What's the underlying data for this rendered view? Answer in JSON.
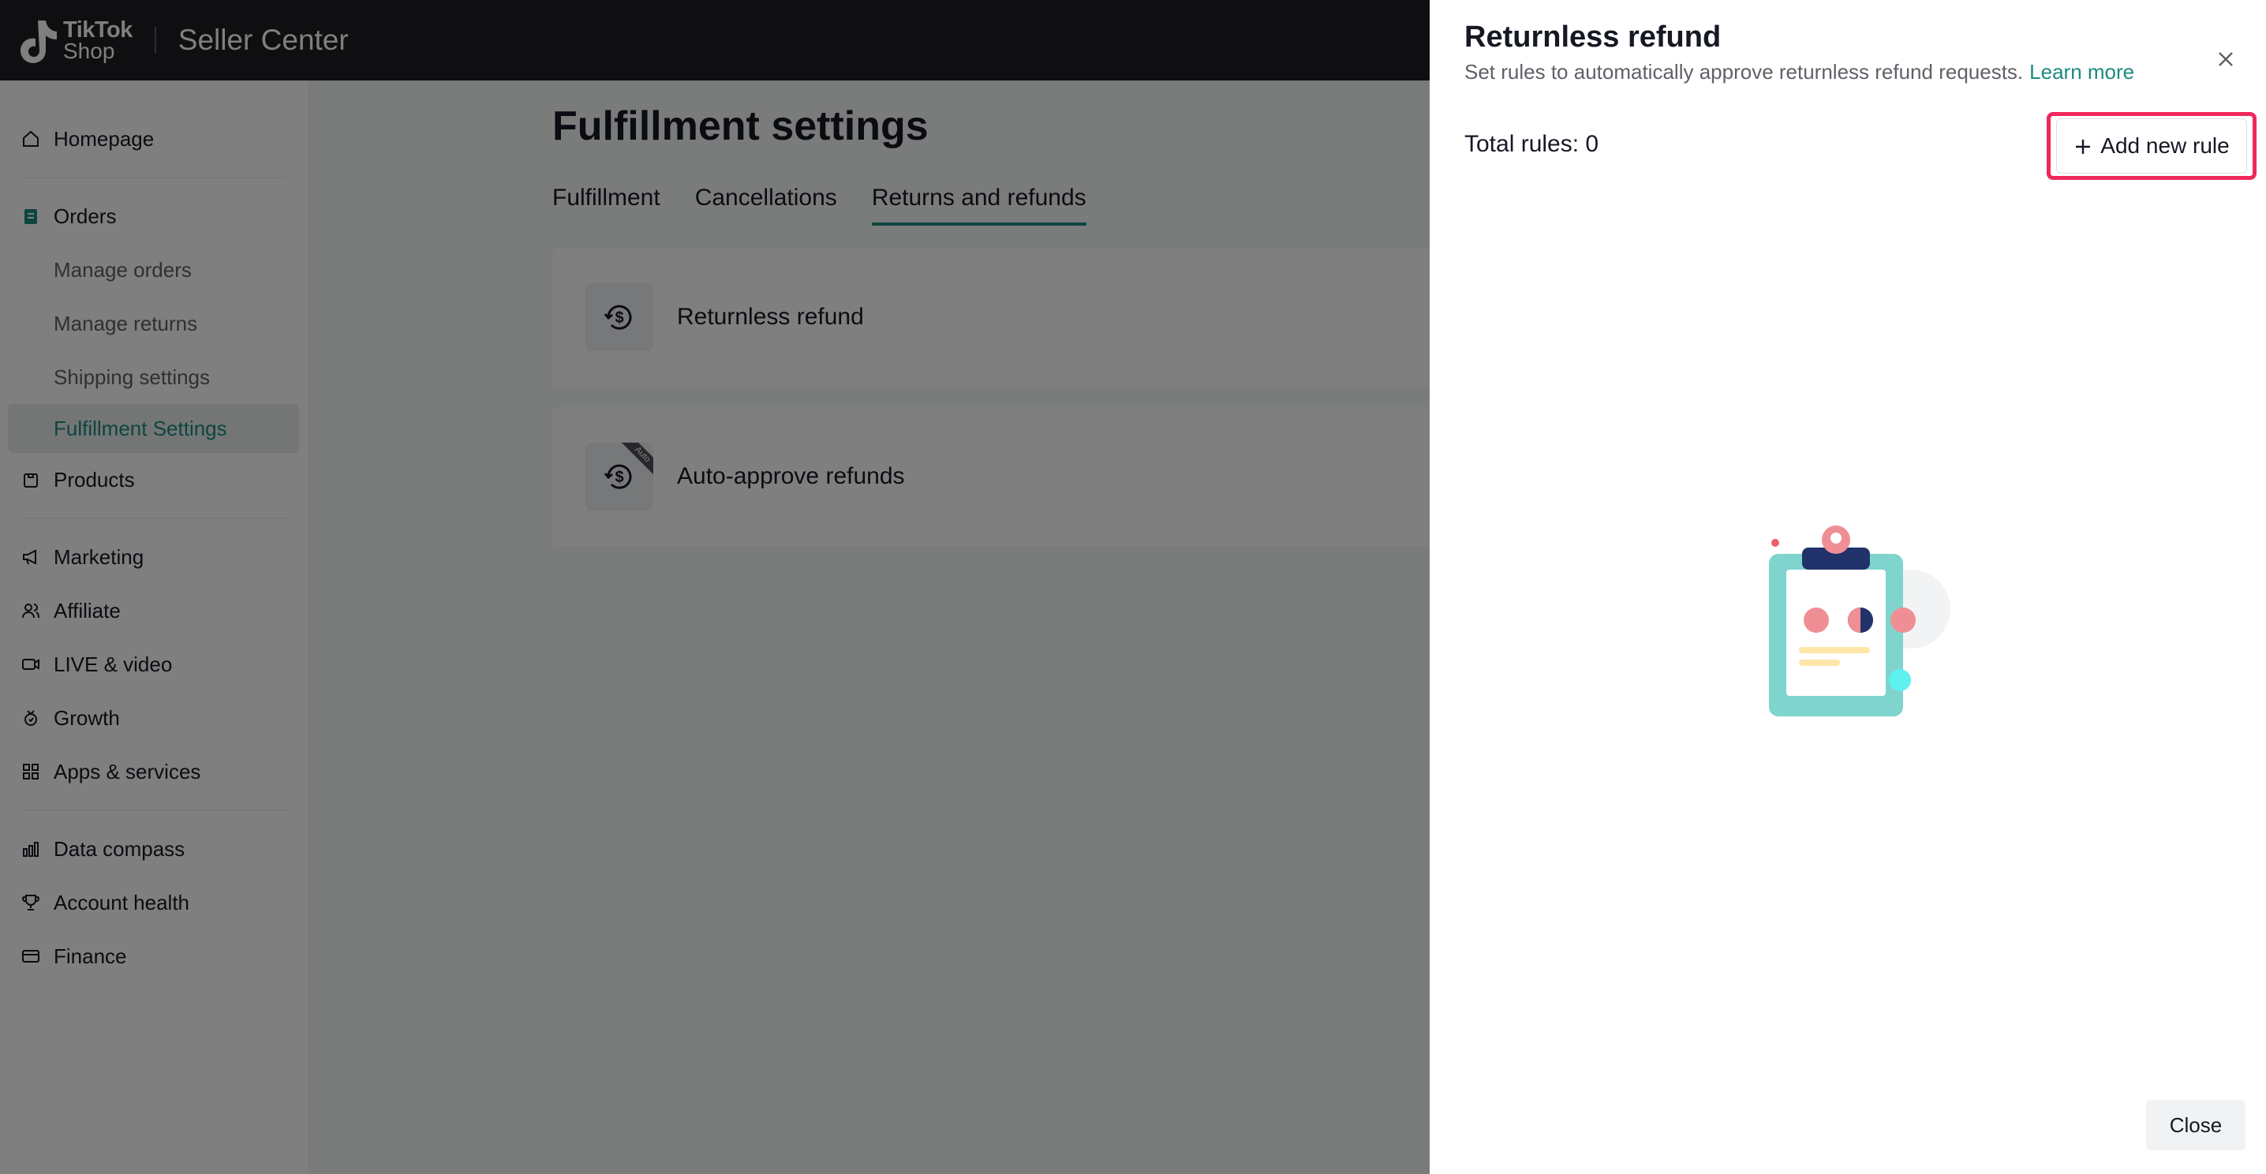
{
  "header": {
    "logo_line1": "TikTok",
    "logo_line2": "Shop",
    "title": "Seller Center"
  },
  "sidebar": {
    "items": [
      {
        "label": "Homepage",
        "icon": "home-icon"
      },
      {
        "label": "Orders",
        "icon": "orders-icon"
      },
      {
        "label": "Manage orders"
      },
      {
        "label": "Manage returns"
      },
      {
        "label": "Shipping settings"
      },
      {
        "label": "Fulfillment Settings",
        "active": true
      },
      {
        "label": "Products",
        "icon": "products-icon"
      },
      {
        "label": "Marketing",
        "icon": "megaphone-icon"
      },
      {
        "label": "Affiliate",
        "icon": "affiliate-icon"
      },
      {
        "label": "LIVE & video",
        "icon": "video-icon"
      },
      {
        "label": "Growth",
        "icon": "growth-icon"
      },
      {
        "label": "Apps & services",
        "icon": "apps-icon"
      },
      {
        "label": "Data compass",
        "icon": "chart-icon"
      },
      {
        "label": "Account health",
        "icon": "trophy-icon"
      },
      {
        "label": "Finance",
        "icon": "finance-icon"
      }
    ]
  },
  "main": {
    "title": "Fulfillment settings",
    "tabs": [
      {
        "label": "Fulfillment"
      },
      {
        "label": "Cancellations"
      },
      {
        "label": "Returns and refunds",
        "active": true
      }
    ],
    "cards": [
      {
        "label": "Returnless refund",
        "icon": "refund-icon"
      },
      {
        "label": "Auto-approve refunds",
        "icon": "auto-refund-icon",
        "badge": "Auto"
      }
    ]
  },
  "drawer": {
    "title": "Returnless refund",
    "description": "Set rules to automatically approve returnless refund requests.",
    "learn_more": "Learn more",
    "total_rules": "Total rules: 0",
    "add_rule_label": "Add new rule",
    "close_label": "Close"
  },
  "colors": {
    "accent": "#1c8a80",
    "highlight": "#f0285a",
    "header_bg": "#1e1f24"
  }
}
